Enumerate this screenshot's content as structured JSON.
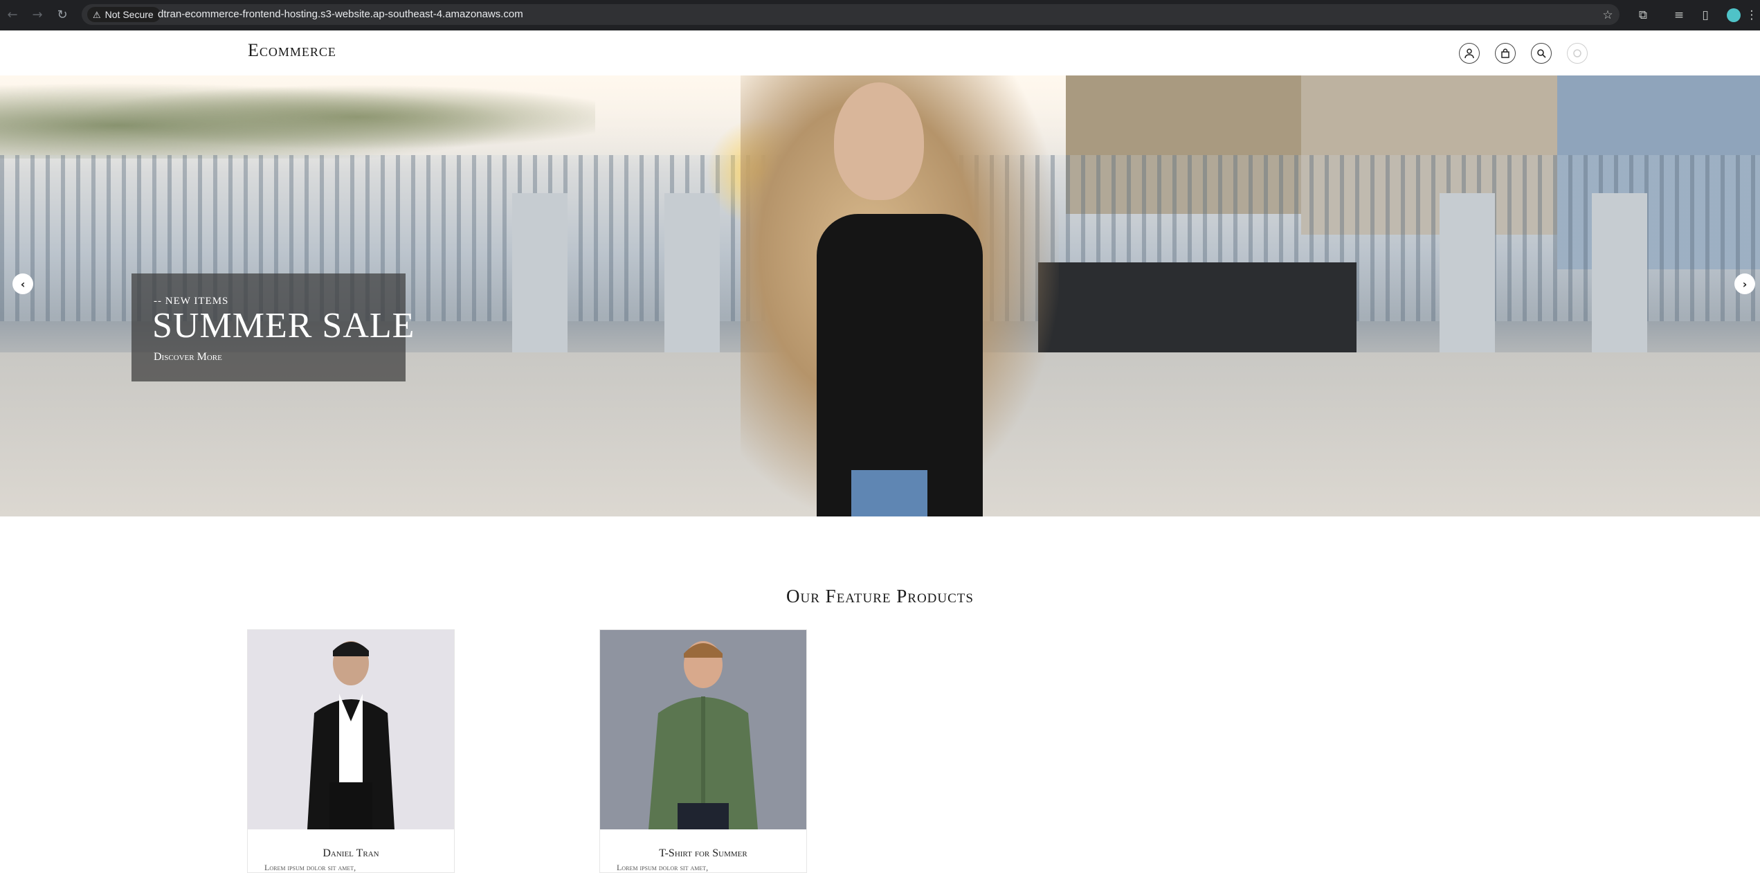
{
  "browser": {
    "security_label": "Not Secure",
    "url": "dtran-ecommerce-frontend-hosting.s3-website.ap-southeast-4.amazonaws.com"
  },
  "header": {
    "logo": "Ecommerce",
    "icons": [
      "user-icon",
      "bag-icon",
      "search-icon",
      "loading-icon"
    ]
  },
  "hero": {
    "eyebrow": "-- NEW ITEMS",
    "headline": "SUMMER SALE",
    "cta": "Discover More"
  },
  "features": {
    "title": "Our Feature Products",
    "products": [
      {
        "name": "Daniel Tran",
        "description": "Lorem ipsum dolor sit amet,"
      },
      {
        "name": "T-Shirt for Summer",
        "description": "Lorem ipsum dolor sit amet,"
      }
    ]
  },
  "colors": {
    "chrome_bg": "#202124",
    "promo_overlay": "#3c3c3c",
    "text": "#1a1a1a"
  }
}
